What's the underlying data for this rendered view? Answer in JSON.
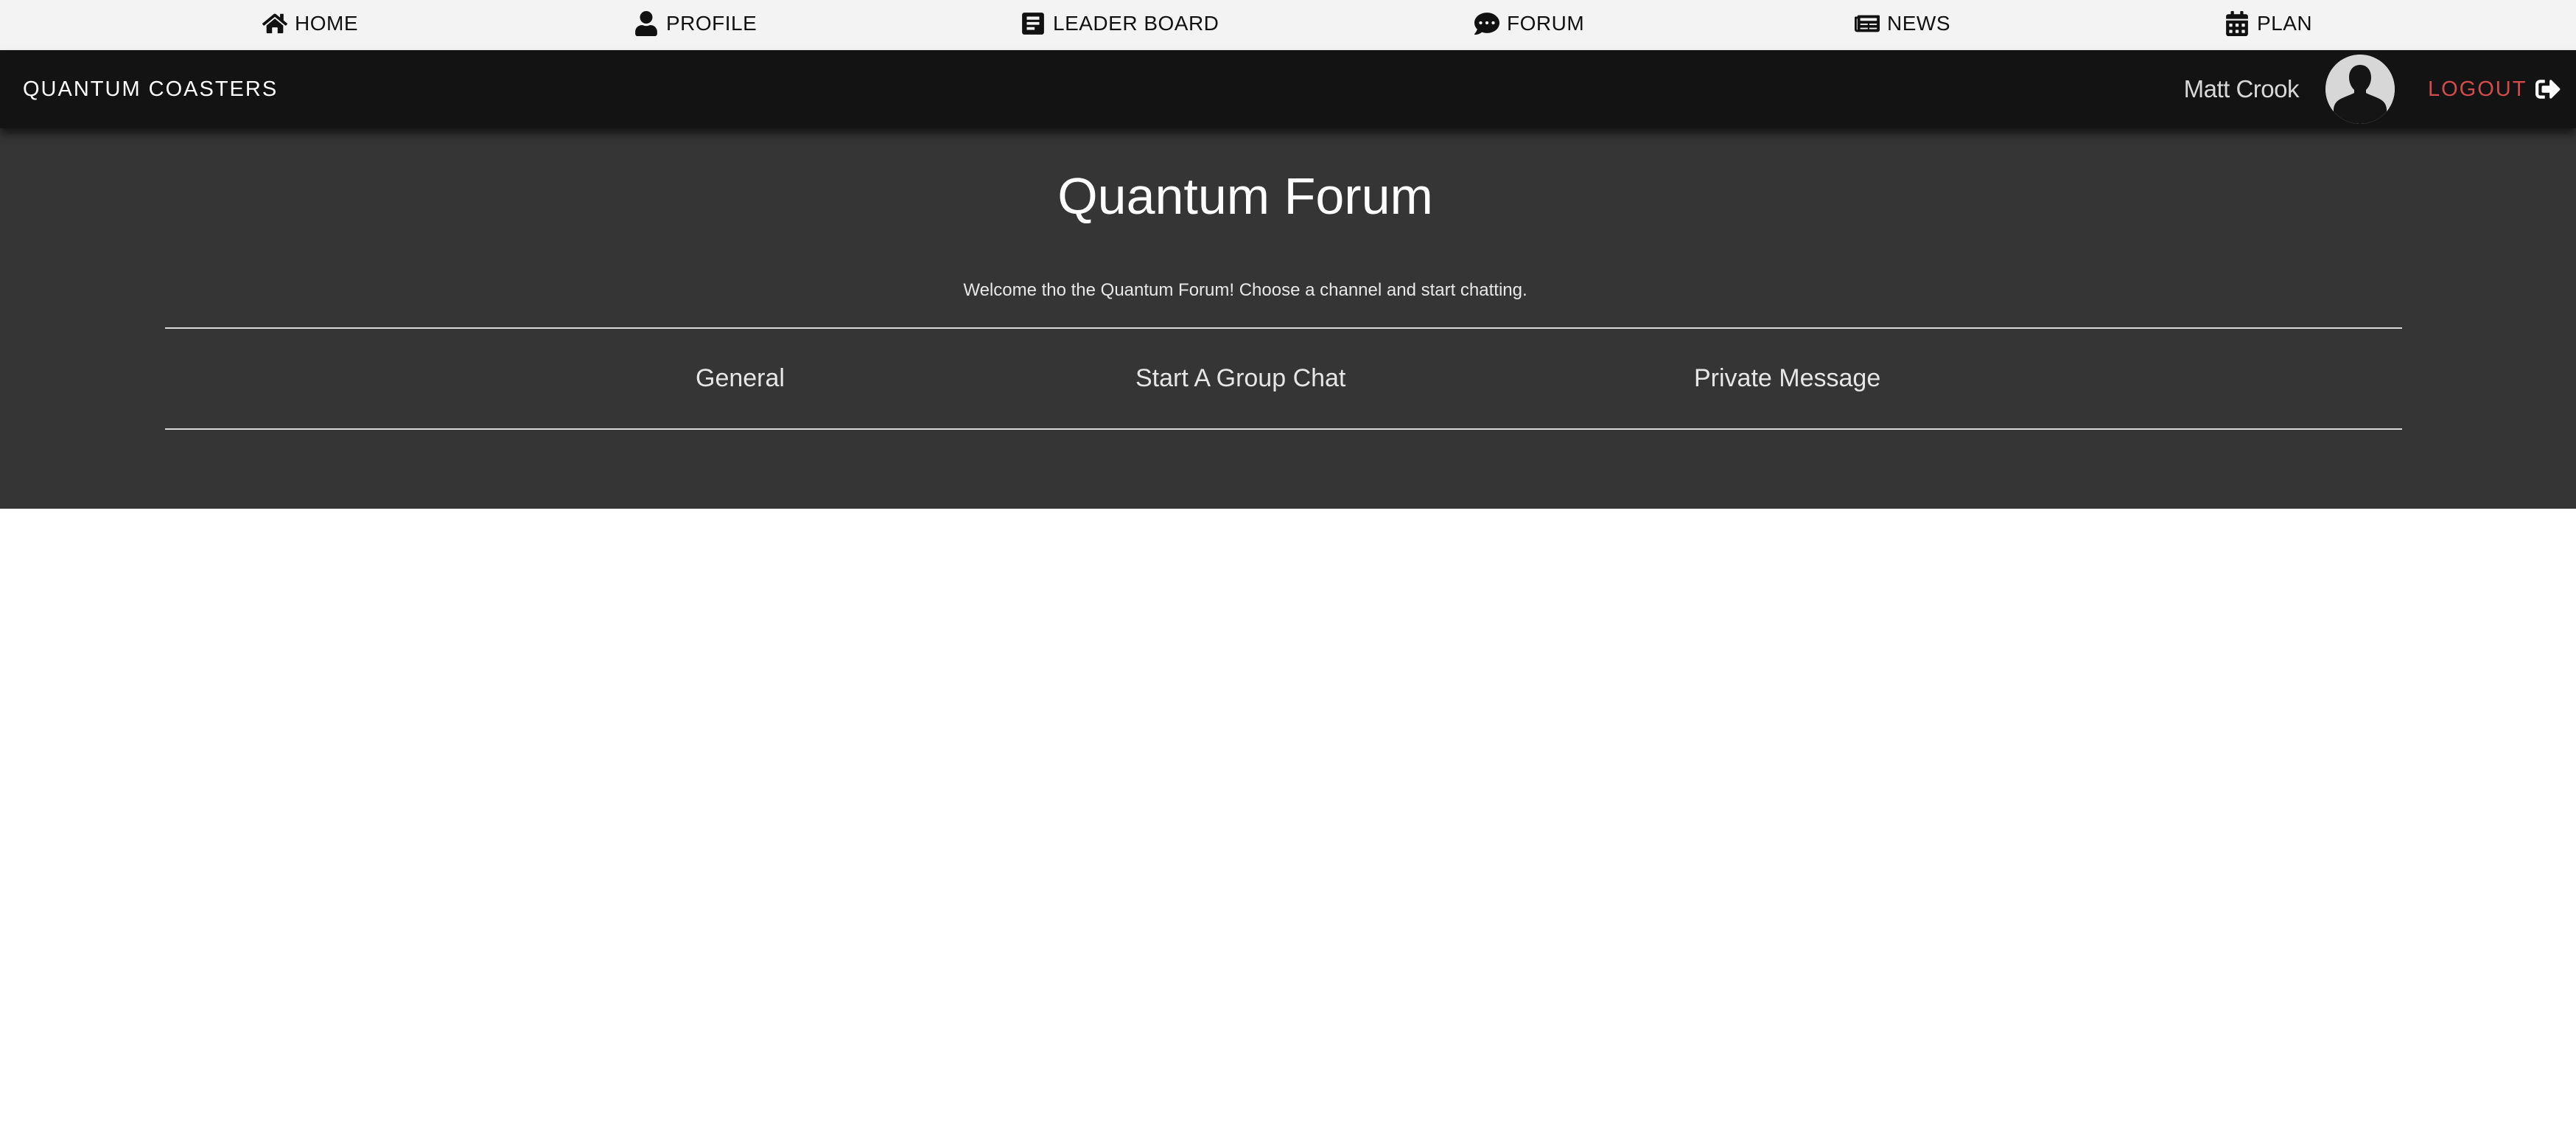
{
  "topnav": {
    "items": [
      {
        "label": "HOME",
        "icon": "home-icon"
      },
      {
        "label": "PROFILE",
        "icon": "user-icon"
      },
      {
        "label": "LEADER BOARD",
        "icon": "leaderboard-icon"
      },
      {
        "label": "FORUM",
        "icon": "chat-icon"
      },
      {
        "label": "NEWS",
        "icon": "newspaper-icon"
      },
      {
        "label": "PLAN",
        "icon": "calendar-icon"
      }
    ]
  },
  "header": {
    "brand": "QUANTUM COASTERS",
    "username": "Matt Crook",
    "avatar_icon": "user-silhouette-icon",
    "logout_label": "LOGOUT",
    "logout_icon": "sign-out-icon",
    "logout_color": "#d34c4c"
  },
  "forum": {
    "title": "Quantum Forum",
    "subtitle": "Welcome tho the Quantum Forum! Choose a channel and start chatting.",
    "channels": [
      {
        "label": "General"
      },
      {
        "label": "Start A Group Chat"
      },
      {
        "label": "Private Message"
      }
    ]
  },
  "colors": {
    "topnav_bg": "#f3f3f3",
    "header_bg": "#131313",
    "hero_bg": "#353535",
    "page_bg": "#ffffff"
  }
}
